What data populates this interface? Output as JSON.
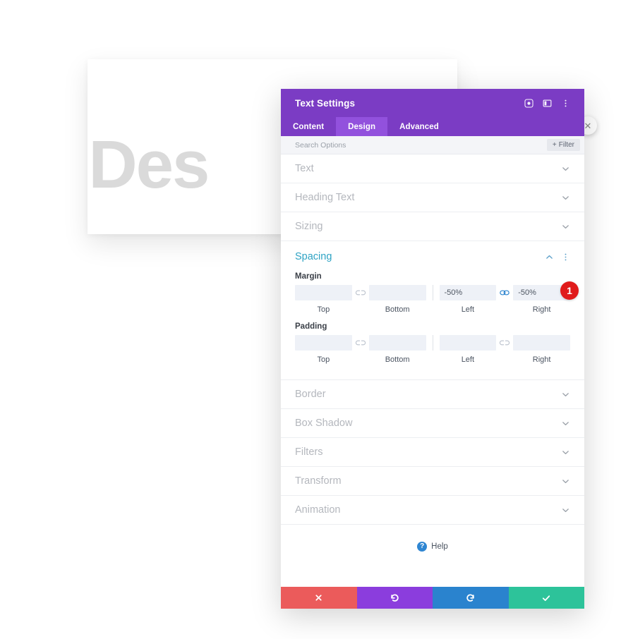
{
  "background": {
    "card_text": "o Des"
  },
  "panel": {
    "title": "Text Settings",
    "header_icons": [
      {
        "name": "focus-target-icon",
        "glyph": "◎"
      },
      {
        "name": "panel-layout-icon",
        "glyph": "▯"
      },
      {
        "name": "more-options-icon",
        "glyph": "⋮"
      }
    ],
    "close_glyph": "✕",
    "tabs": [
      {
        "label": "Content",
        "active": false
      },
      {
        "label": "Design",
        "active": true
      },
      {
        "label": "Advanced",
        "active": false
      }
    ],
    "search": {
      "placeholder": "Search Options",
      "value": ""
    },
    "filter_button": {
      "label": "Filter",
      "plus": "+"
    },
    "sections_top": [
      {
        "label": "Text"
      },
      {
        "label": "Heading Text"
      },
      {
        "label": "Sizing"
      }
    ],
    "spacing": {
      "title": "Spacing",
      "collapse_glyph": "⌃",
      "menu_glyph": "⋮",
      "groups": [
        {
          "label": "Margin",
          "fields": [
            {
              "caption": "Top",
              "value": "",
              "placeholder": ""
            },
            {
              "caption": "Bottom",
              "value": "",
              "placeholder": ""
            },
            {
              "caption": "Left",
              "value": "-50%",
              "placeholder": ""
            },
            {
              "caption": "Right",
              "value": "-50%",
              "placeholder": ""
            }
          ],
          "link_left": {
            "name": "unlink-icon",
            "state": "unlinked"
          },
          "link_right": {
            "name": "link-icon",
            "state": "linked"
          }
        },
        {
          "label": "Padding",
          "fields": [
            {
              "caption": "Top",
              "value": "",
              "placeholder": ""
            },
            {
              "caption": "Bottom",
              "value": "",
              "placeholder": ""
            },
            {
              "caption": "Left",
              "value": "",
              "placeholder": ""
            },
            {
              "caption": "Right",
              "value": "",
              "placeholder": ""
            }
          ],
          "link_left": {
            "name": "unlink-icon",
            "state": "unlinked"
          },
          "link_right": {
            "name": "unlink-icon",
            "state": "unlinked"
          }
        }
      ]
    },
    "sections_bottom": [
      {
        "label": "Border"
      },
      {
        "label": "Box Shadow"
      },
      {
        "label": "Filters"
      },
      {
        "label": "Transform"
      },
      {
        "label": "Animation"
      }
    ],
    "help": {
      "label": "Help",
      "icon_glyph": "?"
    },
    "footer_actions": [
      {
        "name": "cancel",
        "glyph": "✖",
        "color": "#eb5b5b"
      },
      {
        "name": "undo",
        "glyph": "↺",
        "color": "#8b3ddd"
      },
      {
        "name": "redo",
        "glyph": "↻",
        "color": "#2a83ce"
      },
      {
        "name": "save",
        "glyph": "✔",
        "color": "#2dc39a"
      }
    ]
  },
  "annotations": {
    "badge_1": "1"
  },
  "colors": {
    "header_purple": "#7b3cc4",
    "active_tab_purple": "#9251dd",
    "section_open_blue": "#2ea3c4",
    "badge_red": "#e01b1b",
    "input_bg": "#eef1f7"
  }
}
